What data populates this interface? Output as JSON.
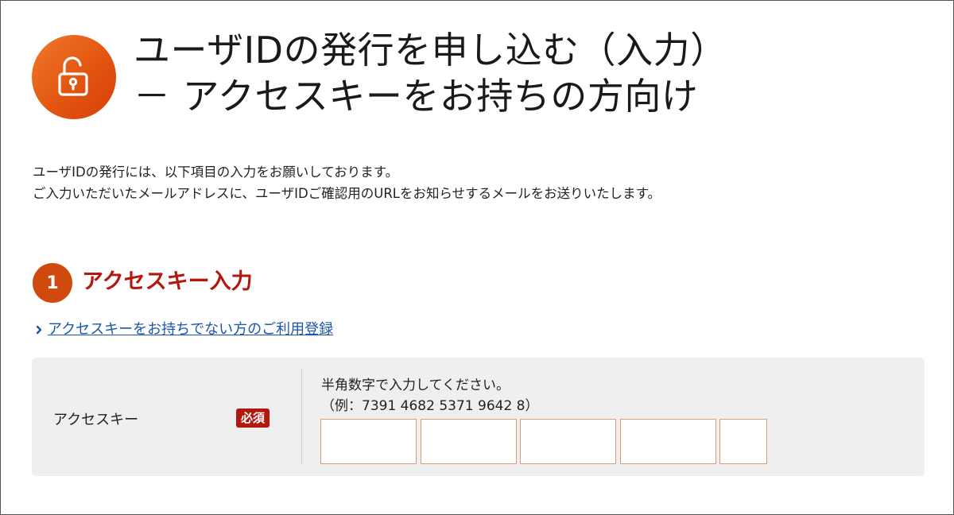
{
  "header": {
    "title_line1": "ユーザIDの発行を申し込む（入力）",
    "title_line2": "－ アクセスキーをお持ちの方向け",
    "icon": "unlock-icon",
    "accent_color": "#e25510"
  },
  "intro": {
    "line1": "ユーザIDの発行には、以下項目の入力をお願いしております。",
    "line2": "ご入力いただいたメールアドレスに、ユーザIDご確認用のURLをお知らせするメールをお送りいたします。"
  },
  "step": {
    "number": "1",
    "title": "アクセスキー入力",
    "badge_color": "#d04a0e",
    "title_color": "#b3170d"
  },
  "links": {
    "register_label": "アクセスキーをお持ちでない方のご利用登録",
    "register_icon": "chevron-right-icon"
  },
  "form": {
    "field_label": "アクセスキー",
    "required_label": "必須",
    "hint_line1": "半角数字で入力してください。",
    "hint_line2": "（例：7391 4682 5371 9642 8）",
    "inputs": [
      {
        "value": ""
      },
      {
        "value": ""
      },
      {
        "value": ""
      },
      {
        "value": ""
      },
      {
        "value": ""
      }
    ]
  }
}
